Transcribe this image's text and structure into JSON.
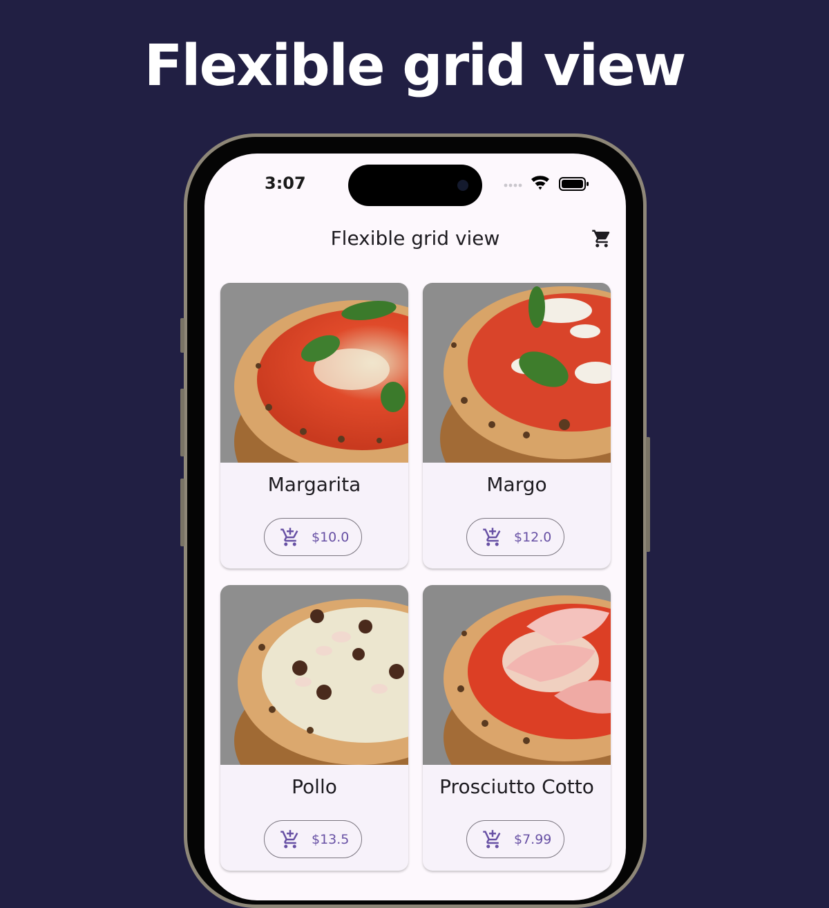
{
  "banner": {
    "title": "Flexible grid view"
  },
  "status_bar": {
    "time": "3:07"
  },
  "app_bar": {
    "title": "Flexible grid view",
    "cart_icon": "shopping-cart-icon"
  },
  "colors": {
    "background": "#211f43",
    "screen": "#fdf8fd",
    "card": "#f7f2fa",
    "accent": "#6750a4"
  },
  "products": [
    {
      "name": "Margarita",
      "price": "$10.0"
    },
    {
      "name": "Margo",
      "price": "$12.0"
    },
    {
      "name": "Pollo",
      "price": "$13.5"
    },
    {
      "name": "Prosciutto Cotto",
      "price": "$7.99"
    }
  ]
}
